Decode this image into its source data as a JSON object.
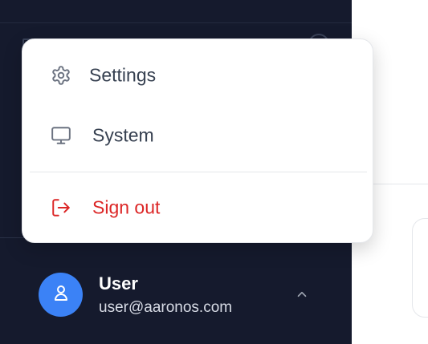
{
  "menu": {
    "items": [
      {
        "label": "Settings",
        "icon": "gear-icon"
      },
      {
        "label": "System",
        "icon": "monitor-icon"
      }
    ],
    "sign_out": {
      "label": "Sign out",
      "icon": "sign-out-icon",
      "color": "#dc2626"
    }
  },
  "user": {
    "name": "User",
    "email": "user@aaronos.com",
    "avatar_icon": "user-icon",
    "avatar_color": "#3b82f6",
    "toggle_icon": "chevron-up-icon"
  },
  "theme": {
    "sidebar_bg": "#151a2d",
    "menu_text": "#374151",
    "danger": "#dc2626"
  }
}
